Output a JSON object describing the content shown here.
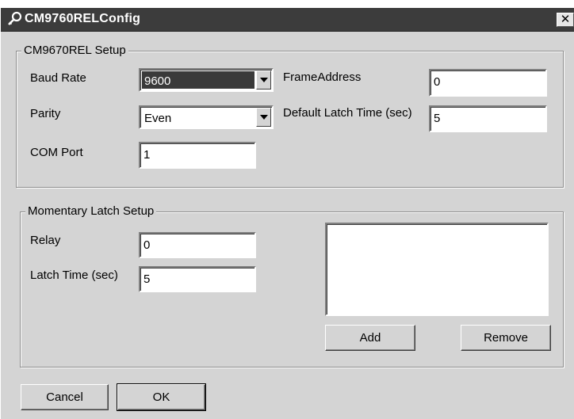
{
  "window": {
    "title": "CM9760RELConfig",
    "close_glyph": "✕",
    "icon": "key-wrench-icon"
  },
  "setup_group": {
    "legend": "CM9670REL Setup",
    "baud_rate": {
      "label": "Baud Rate",
      "value": "9600"
    },
    "parity": {
      "label": "Parity",
      "value": "Even"
    },
    "com_port": {
      "label": "COM Port",
      "value": "1"
    },
    "frame_address": {
      "label": "FrameAddress",
      "value": "0"
    },
    "default_latch_time": {
      "label": "Default Latch Time (sec)",
      "value": "5"
    }
  },
  "momentary_group": {
    "legend": "Momentary Latch Setup",
    "relay": {
      "label": "Relay",
      "value": "0"
    },
    "latch_time": {
      "label": "Latch Time (sec)",
      "value": "5"
    },
    "add_label": "Add",
    "remove_label": "Remove"
  },
  "footer": {
    "cancel_label": "Cancel",
    "ok_label": "OK"
  },
  "colors": {
    "titlebar": "#3c3c3c",
    "dialog_bg": "#d4d4d4",
    "selection": "#3a3a3a"
  }
}
